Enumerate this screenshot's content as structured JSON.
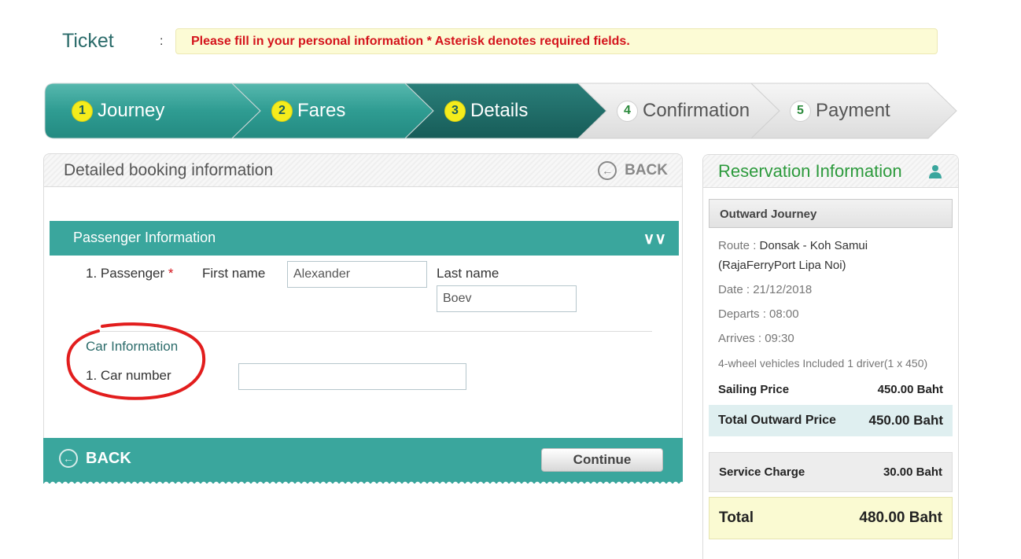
{
  "header": {
    "ticket_label": "Ticket",
    "colon": ":",
    "notice": "Please fill in your personal information * Asterisk denotes required fields."
  },
  "steps": [
    {
      "num": "1",
      "label": "Journey",
      "state": "done"
    },
    {
      "num": "2",
      "label": "Fares",
      "state": "done"
    },
    {
      "num": "3",
      "label": "Details",
      "state": "current"
    },
    {
      "num": "4",
      "label": "Confirmation",
      "state": "todo"
    },
    {
      "num": "5",
      "label": "Payment",
      "state": "todo"
    }
  ],
  "booking": {
    "title": "Detailed booking information",
    "back_label": "BACK",
    "passenger_section": "Passenger Information",
    "passenger_label": "1. Passenger",
    "required_mark": "*",
    "first_name_label": "First name",
    "first_name_value": "Alexander",
    "last_name_label": "Last name",
    "last_name_value": "Boev",
    "car_section": "Car Information",
    "car_number_label": "1. Car number",
    "car_number_value": "",
    "footer_back_label": "BACK",
    "continue_label": "Continue"
  },
  "reservation": {
    "title": "Reservation Information",
    "outward_title": "Outward Journey",
    "route_label": "Route :",
    "route_value": "Donsak - Koh Samui",
    "route_value_2": "(RajaFerryPort Lipa Noi)",
    "date_label": "Date :",
    "date_value": "21/12/2018",
    "departs_label": "Departs :",
    "departs_value": "08:00",
    "arrives_label": "Arrives :",
    "arrives_value": "09:30",
    "vehicle_line": "4-wheel vehicles Included 1 driver(1 x 450)",
    "sailing_label": "Sailing Price",
    "sailing_value": "450.00 Baht",
    "total_out_label": "Total Outward Price",
    "total_out_value": "450.00 Baht",
    "service_label": "Service Charge",
    "service_value": "30.00 Baht",
    "total_label": "Total",
    "total_value": "480.00 Baht"
  },
  "colors": {
    "teal": "#3aa69d",
    "teal_dark": "#1f6e6a",
    "step_yellow": "#f5ec1c",
    "required_red": "#d4141c",
    "green_title": "#2c9a3c",
    "annotation_red": "#e21d1d"
  }
}
